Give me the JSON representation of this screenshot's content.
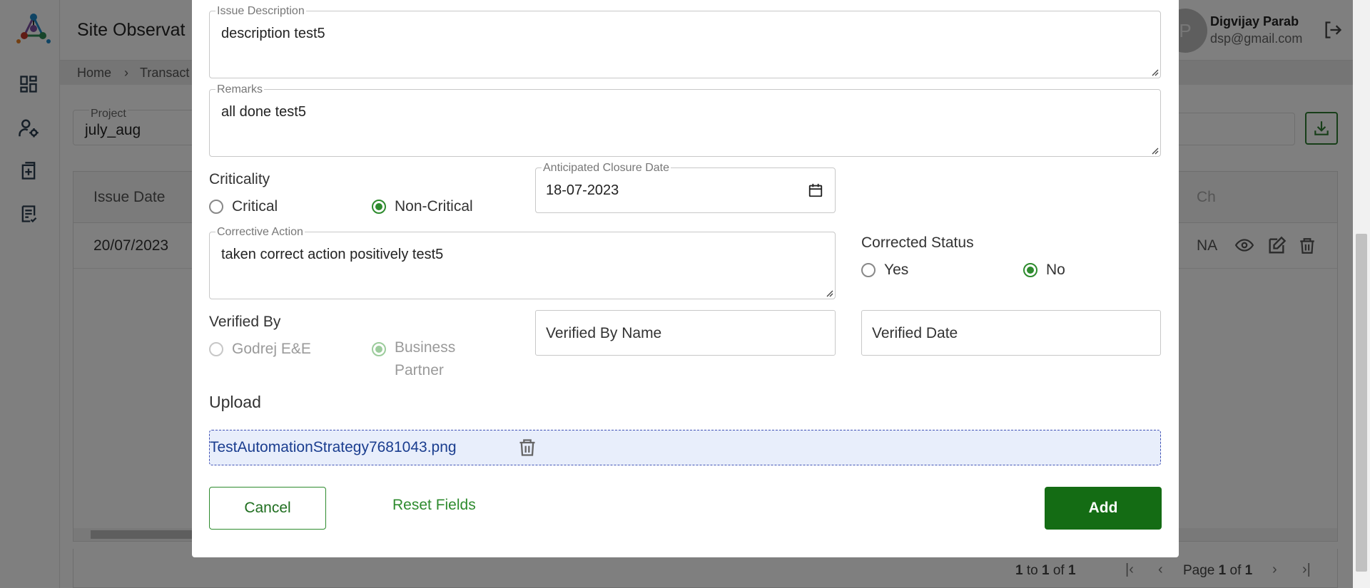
{
  "app": {
    "title": "Site Observat",
    "user": {
      "initial": "P",
      "name": "Digvijay Parab",
      "email": "dsp@gmail.com"
    },
    "breadcrumb": [
      "Home",
      "Transact"
    ],
    "filter": {
      "project_label": "Project",
      "project_value": "july_aug"
    },
    "grid": {
      "headers": {
        "issue_date": "Issue Date",
        "ch": "Ch"
      },
      "rows": [
        {
          "issue_date": "20/07/2023",
          "na": "NA"
        }
      ]
    },
    "pager": {
      "summary_from": "1",
      "summary_to_word": "to",
      "summary_to": "1",
      "summary_of_word": "of",
      "summary_total": "1",
      "page_word": "Page",
      "page_current": "1",
      "page_of_word": "of",
      "page_total": "1"
    }
  },
  "modal": {
    "issue_description": {
      "label": "Issue Description",
      "value": "description test5"
    },
    "remarks": {
      "label": "Remarks",
      "value": "all done test5"
    },
    "criticality": {
      "label": "Criticality",
      "options": [
        "Critical",
        "Non-Critical"
      ],
      "selected": "Non-Critical"
    },
    "anticipated_closure_date": {
      "label": "Anticipated Closure Date",
      "value": "18-07-2023"
    },
    "corrective_action": {
      "label": "Corrective Action",
      "value": "taken correct action positively test5"
    },
    "corrected_status": {
      "label": "Corrected Status",
      "options": [
        "Yes",
        "No"
      ],
      "selected": "No"
    },
    "verified_by": {
      "label": "Verified By",
      "options": [
        "Godrej E&E",
        "Business Partner"
      ],
      "selected": "Business Partner"
    },
    "verified_by_name": {
      "placeholder": "Verified By Name"
    },
    "verified_date": {
      "placeholder": "Verified Date"
    },
    "upload": {
      "label": "Upload",
      "file_name": "TestAutomationStrategy7681043.png"
    },
    "buttons": {
      "cancel": "Cancel",
      "reset": "Reset Fields",
      "add": "Add"
    }
  },
  "colors": {
    "primary_green": "#146c14",
    "accent_green": "#2e8b2e",
    "upload_bg": "#e8eefb",
    "file_link": "#1a3d8f"
  },
  "icons": [
    "app-logo-icon",
    "dashboard-icon",
    "user-settings-icon",
    "add-document-icon",
    "checklist-icon",
    "logout-icon",
    "download-icon",
    "view-icon",
    "edit-icon",
    "trash-icon",
    "calendar-icon"
  ]
}
